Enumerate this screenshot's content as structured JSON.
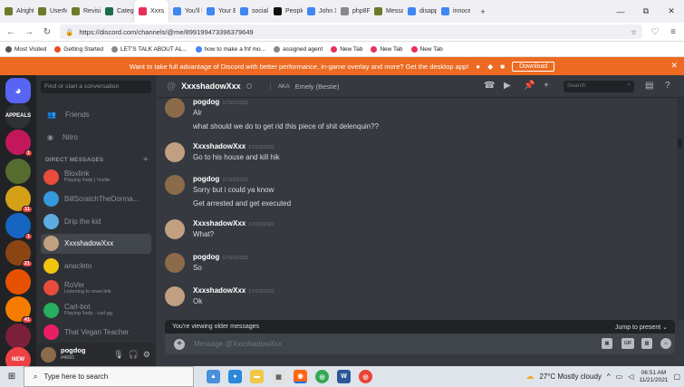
{
  "browser": {
    "tabs": [
      {
        "label": "Alright",
        "color": "#6c7a2b"
      },
      {
        "label": "UserM",
        "color": "#6c7a2b"
      },
      {
        "label": "Revisio",
        "color": "#6c7a2b"
      },
      {
        "label": "Catego",
        "color": "#1e6b4a"
      },
      {
        "label": "Xxxs",
        "color": "#e8315a",
        "active": true
      },
      {
        "label": "You'll t",
        "color": "#4285f4"
      },
      {
        "label": "Your Ey",
        "color": "#4285f4"
      },
      {
        "label": "social e",
        "color": "#4285f4"
      },
      {
        "label": "People",
        "color": "#111111"
      },
      {
        "label": "John X",
        "color": "#4285f4"
      },
      {
        "label": "php8F",
        "color": "#888888"
      },
      {
        "label": "Messag",
        "color": "#6c7a2b"
      },
      {
        "label": "disapp",
        "color": "#4285f4"
      },
      {
        "label": "innoce",
        "color": "#4285f4"
      }
    ],
    "new_tab_symbol": "+",
    "window_controls": {
      "minimize": "—",
      "maximize": "⧉",
      "close": "✕"
    },
    "url": "https://discord.com/channels/@me/899199473396379649",
    "bookmarks": [
      {
        "label": "Most Visited",
        "color": "#555555"
      },
      {
        "label": "Getting Started",
        "color": "#e34c26"
      },
      {
        "label": "LET'S TALK ABOUT AL...",
        "color": "#888888"
      },
      {
        "label": "how to make a fnf mo...",
        "color": "#4285f4"
      },
      {
        "label": "assigned agent",
        "color": "#888888"
      },
      {
        "label": "New Tab",
        "color": "#e8315a"
      },
      {
        "label": "New Tab",
        "color": "#e8315a"
      },
      {
        "label": "New Tab",
        "color": "#e8315a"
      }
    ]
  },
  "promo": {
    "text": "Want to take full advantage of Discord with better performance, in-game overlay and more? Get the desktop app!",
    "download_label": "Download",
    "close_symbol": "✕"
  },
  "servers": [
    {
      "label": "",
      "color": "#5865f2",
      "badge": ""
    },
    {
      "label": "APPEALS",
      "color": "#2f3136",
      "badge": ""
    },
    {
      "label": "",
      "color": "#c2185b",
      "badge": "1"
    },
    {
      "label": "",
      "color": "#556b2f",
      "badge": ""
    },
    {
      "label": "",
      "color": "#d4a017",
      "badge": "11"
    },
    {
      "label": "",
      "color": "#1565c0",
      "badge": "1"
    },
    {
      "label": "",
      "color": "#8b4513",
      "badge": "21"
    },
    {
      "label": "",
      "color": "#e65100",
      "badge": ""
    },
    {
      "label": "",
      "color": "#f57c00",
      "badge": "41"
    },
    {
      "label": "",
      "color": "#7b1f3a",
      "badge": ""
    },
    {
      "label": "NEW",
      "color": "#ed4245",
      "badge": ""
    }
  ],
  "sidebar": {
    "search_placeholder": "Find or start a conversation",
    "friends_label": "Friends",
    "nitro_label": "Nitro",
    "dm_header": "DIRECT MESSAGES",
    "add_symbol": "+",
    "dms": [
      {
        "name": "Bloxlink",
        "status": "Playing !help | !invite",
        "color": "#e74c3c"
      },
      {
        "name": "BillScratchTheDorma...",
        "status": "",
        "color": "#3498db"
      },
      {
        "name": "Drip the kid",
        "status": "",
        "color": "#5dade2"
      },
      {
        "name": "XxxshadowXxx",
        "status": "",
        "color": "#c0a080",
        "selected": true
      },
      {
        "name": "anacleto",
        "status": "",
        "color": "#f1c40f"
      },
      {
        "name": "RoVer",
        "status": "Listening to rover.link",
        "color": "#e74c3c"
      },
      {
        "name": "Carl-bot",
        "status": "Playing !help - carl.gg",
        "color": "#27ae60"
      },
      {
        "name": "That Vegan Teacher",
        "status": "",
        "color": "#e91e63"
      }
    ],
    "user": {
      "name": "pogdog",
      "tag": "#4691"
    }
  },
  "header": {
    "at_symbol": "@",
    "channel_name": "XxxshadowXxx",
    "aka_label": "AKA",
    "nickname": "Emely (Bestie)",
    "search_placeholder": "Search"
  },
  "messages": [
    {
      "user": "pogdog",
      "time": "17/10/2021",
      "lines": [
        "Alr",
        "what should we do to get rid this piece of shit delenquin??"
      ]
    },
    {
      "user": "XxxshadowXxx",
      "time": "17/10/2021",
      "lines": [
        "Go to his house and kill hik"
      ]
    },
    {
      "user": "pogdog",
      "time": "17/10/2021",
      "lines": [
        "Sorry but i could ya know",
        "Get arrested and get executed"
      ]
    },
    {
      "user": "XxxshadowXxx",
      "time": "17/10/2021",
      "lines": [
        "What?"
      ]
    },
    {
      "user": "pogdog",
      "time": "17/10/2021",
      "lines": [
        "So"
      ]
    },
    {
      "user": "XxxshadowXxx",
      "time": "17/10/2021",
      "lines": [
        "Ok"
      ]
    }
  ],
  "older_bar": {
    "text": "You're viewing older messages",
    "jump_label": "Jump to present"
  },
  "composer": {
    "placeholder": "Message @XxxshadowXxx",
    "gif_label": "GIF"
  },
  "taskbar": {
    "search_placeholder": "Type here to search",
    "weather": "27°C  Mostly cloudy",
    "time": "06:51 AM",
    "date": "11/21/2021"
  }
}
